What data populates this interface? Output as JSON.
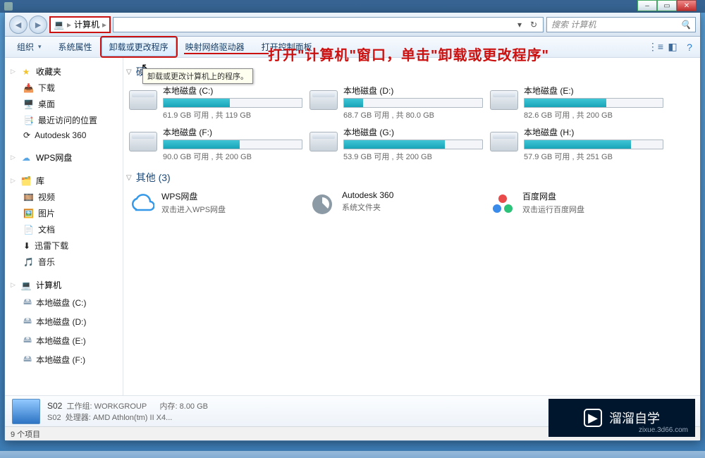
{
  "breadcrumb": {
    "root_icon": "💻",
    "root": "计算机",
    "chev": "▸"
  },
  "search": {
    "placeholder": "搜索 计算机"
  },
  "toolbar": {
    "organize": "组织",
    "sysprops": "系统属性",
    "uninstall": "卸载或更改程序",
    "mapdrive": "映射网络驱动器",
    "ctrlpanel": "打开控制面板"
  },
  "tooltip": "卸载或更改计算机上的程序。",
  "annotation": "打开\"计算机\"窗口，单击\"卸载或更改程序\"",
  "sidebar": {
    "fav": {
      "label": "收藏夹",
      "items": [
        "下载",
        "桌面",
        "最近访问的位置",
        "Autodesk 360"
      ]
    },
    "wps": "WPS网盘",
    "lib": {
      "label": "库",
      "items": [
        "视频",
        "图片",
        "文档",
        "迅雷下载",
        "音乐"
      ]
    },
    "pc": {
      "label": "计算机",
      "items": [
        "本地磁盘 (C:)",
        "本地磁盘 (D:)",
        "本地磁盘 (E:)",
        "本地磁盘 (F:)"
      ]
    }
  },
  "main": {
    "hdd_header": "硬",
    "drives": [
      {
        "name": "本地磁盘 (C:)",
        "free": "61.9 GB 可用 , 共 119 GB",
        "pct": 48
      },
      {
        "name": "本地磁盘 (D:)",
        "free": "68.7 GB 可用 , 共 80.0 GB",
        "pct": 14
      },
      {
        "name": "本地磁盘 (E:)",
        "free": "82.6 GB 可用 , 共 200 GB",
        "pct": 59
      },
      {
        "name": "本地磁盘 (F:)",
        "free": "90.0 GB 可用 , 共 200 GB",
        "pct": 55
      },
      {
        "name": "本地磁盘 (G:)",
        "free": "53.9 GB 可用 , 共 200 GB",
        "pct": 73
      },
      {
        "name": "本地磁盘 (H:)",
        "free": "57.9 GB 可用 , 共 251 GB",
        "pct": 77
      }
    ],
    "other_header": "其他 (3)",
    "others": [
      {
        "title": "WPS网盘",
        "sub": "双击进入WPS网盘"
      },
      {
        "title": "Autodesk 360",
        "sub": "系统文件夹"
      },
      {
        "title": "百度网盘",
        "sub": "双击运行百度网盘"
      }
    ]
  },
  "details": {
    "name": "S02",
    "workgroup_label": "工作组:",
    "workgroup": "WORKGROUP",
    "mem_label": "内存:",
    "mem": "8.00 GB",
    "line2a": "S02",
    "cpu_label": "处理器:",
    "cpu": "AMD Athlon(tm) II X4..."
  },
  "status": "9 个项目",
  "watermark": {
    "text": "溜溜自学",
    "sub": "zixue.3d66.com"
  }
}
